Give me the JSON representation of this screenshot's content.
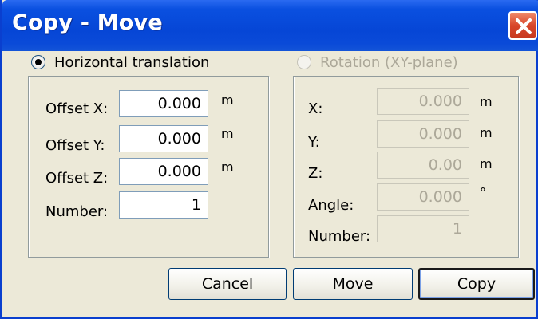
{
  "window": {
    "title": "Copy - Move"
  },
  "left_group": {
    "radio_label": "Horizontal translation",
    "selected": true,
    "fields": [
      {
        "label": "Offset X:",
        "value": "0.000",
        "unit": "m"
      },
      {
        "label": "Offset Y:",
        "value": "0.000",
        "unit": "m"
      },
      {
        "label": "Offset Z:",
        "value": "0.000",
        "unit": "m"
      },
      {
        "label": "Number:",
        "value": "1",
        "unit": ""
      }
    ]
  },
  "right_group": {
    "radio_label": "Rotation (XY-plane)",
    "enabled": false,
    "fields": [
      {
        "label": "X:",
        "value": "0.000",
        "unit": "m"
      },
      {
        "label": "Y:",
        "value": "0.000",
        "unit": "m"
      },
      {
        "label": "Z:",
        "value": "0.00",
        "unit": "m"
      },
      {
        "label": "Angle:",
        "value": "0.000",
        "unit": "°"
      },
      {
        "label": "Number:",
        "value": "1",
        "unit": ""
      }
    ]
  },
  "buttons": {
    "cancel": "Cancel",
    "move": "Move",
    "copy": "Copy"
  }
}
